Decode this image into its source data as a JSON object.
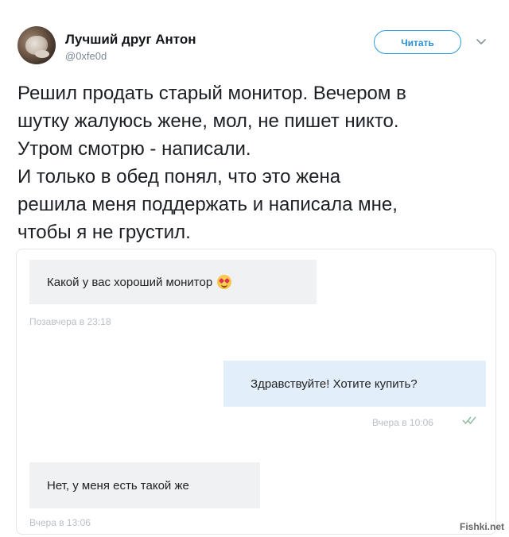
{
  "tweet": {
    "user_name": "Лучший друг Антон",
    "user_handle": "@0xfe0d",
    "follow_label": "Читать",
    "text": "Решил продать старый монитор. Вечером в\nшутку жалуюсь жене, мол, не пишет никто.\nУтром смотрю - написали.\nИ только в обед понял, что это жена\nрешила меня поддержать и написала мне,\nчтобы я не грустил."
  },
  "chat": {
    "messages": [
      {
        "direction": "incoming",
        "text": "Какой у вас хороший монитор",
        "emoji": "smiling-face-with-heart-eyes-icon",
        "timestamp": "Позавчера в 23:18"
      },
      {
        "direction": "outgoing",
        "text": "Здравствуйте! Хотите купить?",
        "timestamp": "Вчера в 10:06",
        "read_status": "double-check-icon"
      },
      {
        "direction": "incoming",
        "text": "Нет, у меня есть такой же",
        "timestamp": "Вчера в 13:06"
      }
    ]
  },
  "watermark": "Fishki.net",
  "colors": {
    "accent": "#2d9be0",
    "incoming_bubble": "#eff1f3",
    "outgoing_bubble": "#e3eefb",
    "timestamp": "#b9c0c6"
  }
}
